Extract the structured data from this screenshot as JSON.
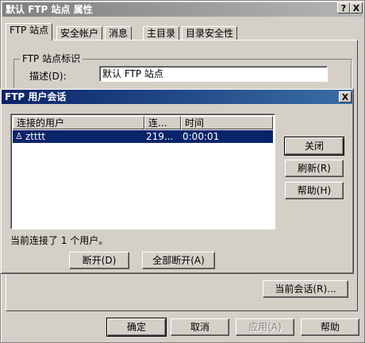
{
  "main_window": {
    "title": "默认 FTP 站点 属性",
    "help_btn": "?",
    "close_btn": "X",
    "tabs": [
      "FTP 站点",
      "安全帐户",
      "消息",
      "主目录",
      "目录安全性"
    ],
    "group_label": "FTP 站点标识",
    "desc_label": "描述(D):",
    "desc_value": "默认 FTP 站点",
    "current_sessions_btn": "当前会话(R)...",
    "ok_btn": "确定",
    "cancel_btn": "取消",
    "apply_btn": "应用(A)",
    "help_bottom_btn": "帮助"
  },
  "sessions_dialog": {
    "title": "FTP 用户会话",
    "close_btn": "X",
    "columns": [
      "连接的用户",
      "连...",
      "时间"
    ],
    "rows": [
      {
        "user": "ztttt",
        "from": "219...",
        "time": "0:00:01"
      }
    ],
    "status": "当前连接了 1 个用户。",
    "disconnect_btn": "断开(D)",
    "disconnect_all_btn": "全部断开(A)",
    "close_action_btn": "关闭",
    "refresh_btn": "刷新(R)",
    "help_btn": "帮助(H)"
  }
}
